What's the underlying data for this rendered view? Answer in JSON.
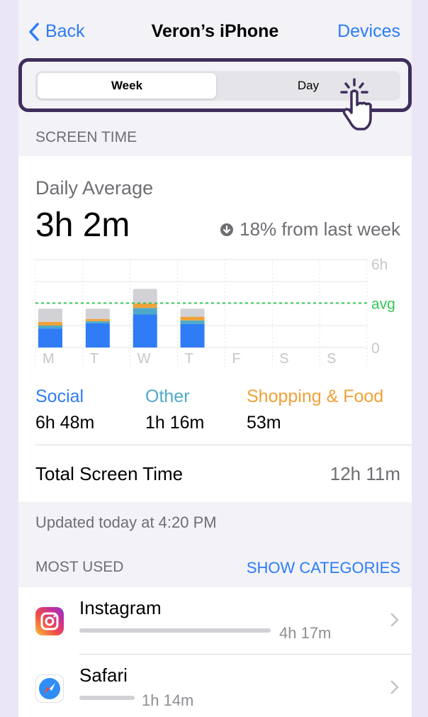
{
  "nav": {
    "back_label": "Back",
    "title": "Veron’s iPhone",
    "devices_label": "Devices"
  },
  "segment": {
    "week_label": "Week",
    "day_label": "Day",
    "selected": "Week"
  },
  "screen_time": {
    "section_header": "SCREEN TIME",
    "daily_average_label": "Daily Average",
    "daily_average_value": "3h 2m",
    "change_text": "18% from last week",
    "change_direction": "down"
  },
  "chart_data": {
    "type": "bar",
    "stacked": true,
    "categories": [
      "M",
      "T",
      "W",
      "T",
      "F",
      "S",
      "S"
    ],
    "y_ticks": [
      "6h",
      "avg",
      "0"
    ],
    "ylim": [
      0,
      6
    ],
    "average": 3.03,
    "series": [
      {
        "name": "Social",
        "color": "#2f7cf6",
        "values": [
          1.3,
          1.65,
          2.25,
          1.6,
          0,
          0,
          0
        ]
      },
      {
        "name": "Other",
        "color": "#4fa9c8",
        "values": [
          0.2,
          0.15,
          0.45,
          0.25,
          0,
          0,
          0
        ]
      },
      {
        "name": "Shopping & Food",
        "color": "#f0a238",
        "values": [
          0.25,
          0.15,
          0.3,
          0.25,
          0,
          0,
          0
        ]
      },
      {
        "color": "#d1d1d6",
        "values": [
          0.9,
          0.7,
          1.0,
          0.55,
          0,
          0,
          0
        ]
      }
    ],
    "grid": true
  },
  "categories": [
    {
      "name": "Social",
      "value": "6h 48m",
      "color": "#2f7cf6"
    },
    {
      "name": "Other",
      "value": "1h 16m",
      "color": "#4fa9c8"
    },
    {
      "name": "Shopping & Food",
      "value": "53m",
      "color": "#f0a238"
    }
  ],
  "total": {
    "label": "Total Screen Time",
    "value": "12h 11m"
  },
  "updated_text": "Updated today at 4:20 PM",
  "most_used": {
    "header": "MOST USED",
    "show_categories_label": "SHOW CATEGORIES",
    "apps": [
      {
        "name": "Instagram",
        "time": "4h 17m",
        "icon": "instagram-icon",
        "share": 1.0
      },
      {
        "name": "Safari",
        "time": "1h 14m",
        "icon": "safari-icon",
        "share": 0.29
      }
    ]
  }
}
